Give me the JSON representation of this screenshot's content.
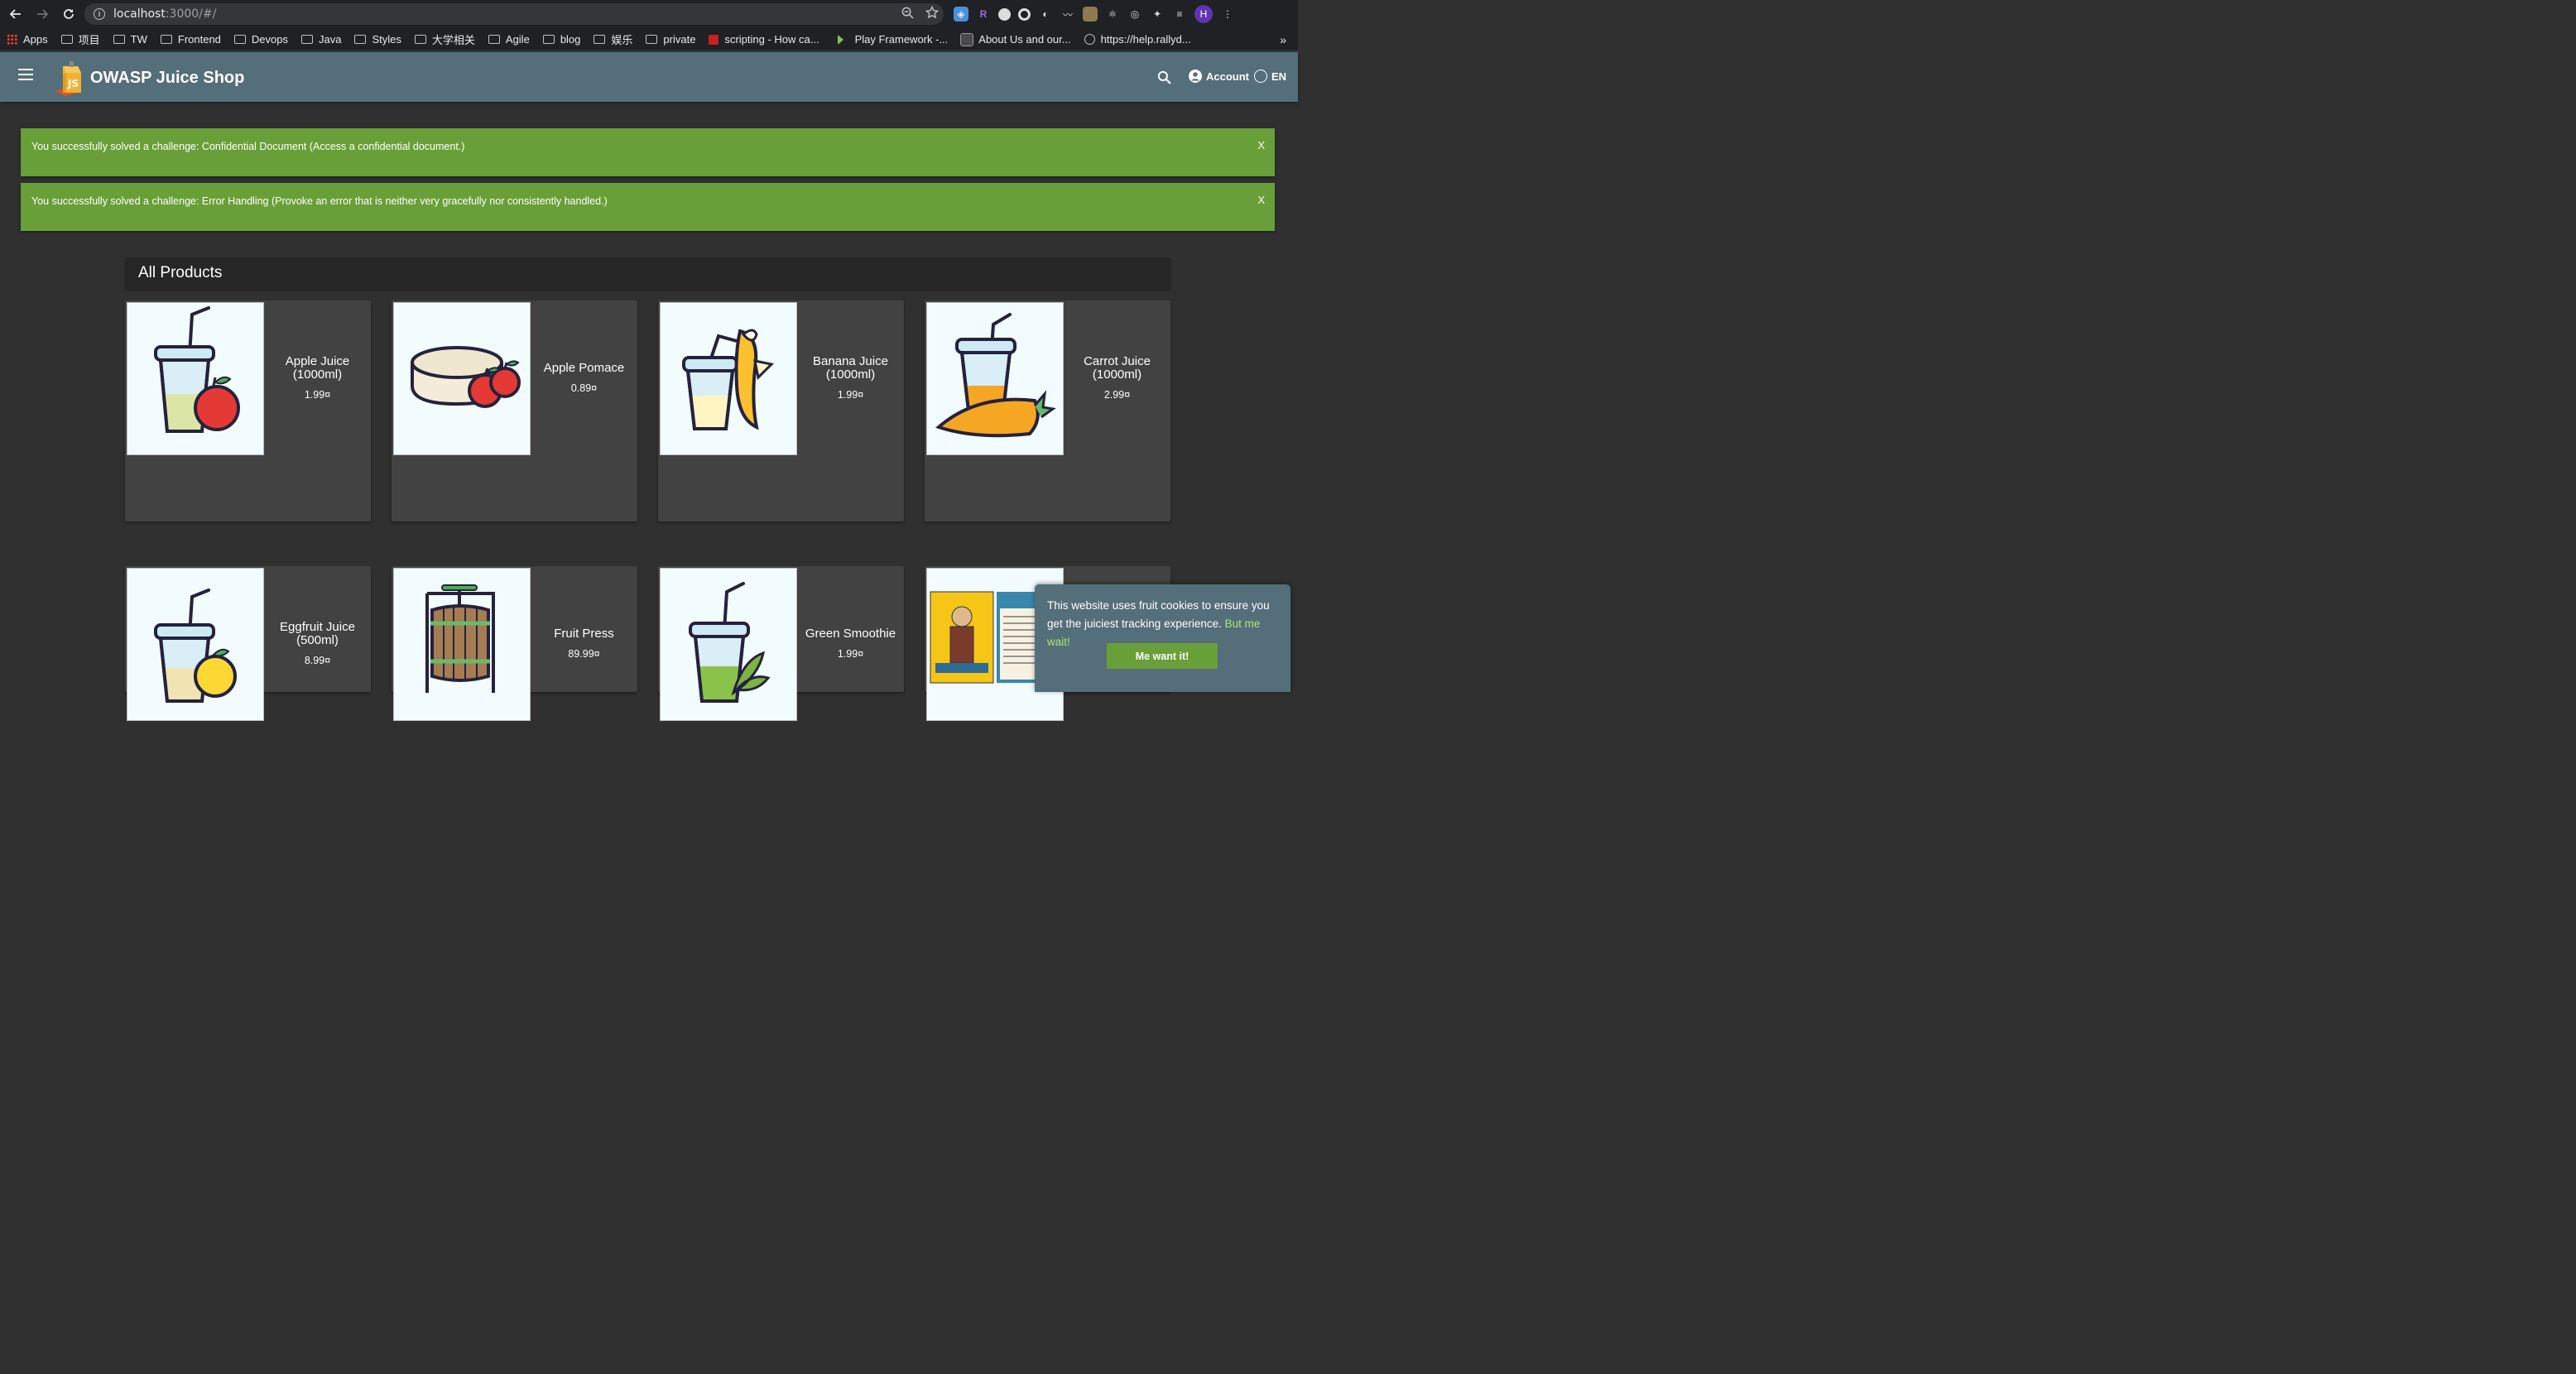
{
  "browser": {
    "url_host": "localhost",
    "url_path": ":3000/#/",
    "avatar_letter": "H",
    "bookmarks": [
      {
        "label": "Apps",
        "icon": "apps-grid-icon"
      },
      {
        "label": "项目",
        "icon": "folder-icon"
      },
      {
        "label": "TW",
        "icon": "folder-icon"
      },
      {
        "label": "Frontend",
        "icon": "folder-icon"
      },
      {
        "label": "Devops",
        "icon": "folder-icon"
      },
      {
        "label": "Java",
        "icon": "folder-icon"
      },
      {
        "label": "Styles",
        "icon": "folder-icon"
      },
      {
        "label": "大学相关",
        "icon": "folder-icon"
      },
      {
        "label": "Agile",
        "icon": "folder-icon"
      },
      {
        "label": "blog",
        "icon": "folder-icon"
      },
      {
        "label": "娱乐",
        "icon": "folder-icon"
      },
      {
        "label": "private",
        "icon": "folder-icon"
      },
      {
        "label": "scripting - How ca...",
        "icon": "page-favicon"
      },
      {
        "label": "Play Framework -...",
        "icon": "play-favicon"
      },
      {
        "label": "About Us and our...",
        "icon": "page-favicon"
      },
      {
        "label": "https://help.rallyd...",
        "icon": "globe-icon"
      }
    ],
    "more_label": "»"
  },
  "app": {
    "title": "OWASP Juice Shop",
    "account_label": "Account",
    "language_label": "EN"
  },
  "snackbars": [
    {
      "message": "You successfully solved a challenge: Confidential Document (Access a confidential document.)",
      "close": "X"
    },
    {
      "message": "You successfully solved a challenge: Error Handling (Provoke an error that is neither very gracefully nor consistently handled.)",
      "close": "X"
    }
  ],
  "products": {
    "heading": "All Products",
    "items": [
      {
        "name": "Apple Juice (1000ml)",
        "price": "1.99¤",
        "image": "juice-cup-apple"
      },
      {
        "name": "Apple Pomace",
        "price": "0.89¤",
        "image": "pomace-cake-apples"
      },
      {
        "name": "Banana Juice (1000ml)",
        "price": "1.99¤",
        "image": "juice-cup-banana"
      },
      {
        "name": "Carrot Juice (1000ml)",
        "price": "2.99¤",
        "image": "juice-cup-carrot"
      },
      {
        "name": "Eggfruit Juice (500ml)",
        "price": "8.99¤",
        "image": "juice-cup-eggfruit"
      },
      {
        "name": "Fruit Press",
        "price": "89.99¤",
        "image": "fruit-press"
      },
      {
        "name": "Green Smoothie",
        "price": "1.99¤",
        "image": "juice-cup-green"
      },
      {
        "name": "",
        "price": "",
        "image": "menu-poster"
      }
    ]
  },
  "cookie_banner": {
    "text": "This website uses fruit cookies to ensure you get the juiciest tracking experience.",
    "link": "But me wait!",
    "button": "Me want it!"
  },
  "colors": {
    "toolbar": "#546e7a",
    "snackbar": "#689f38",
    "background": "#303030",
    "card": "#424242"
  }
}
